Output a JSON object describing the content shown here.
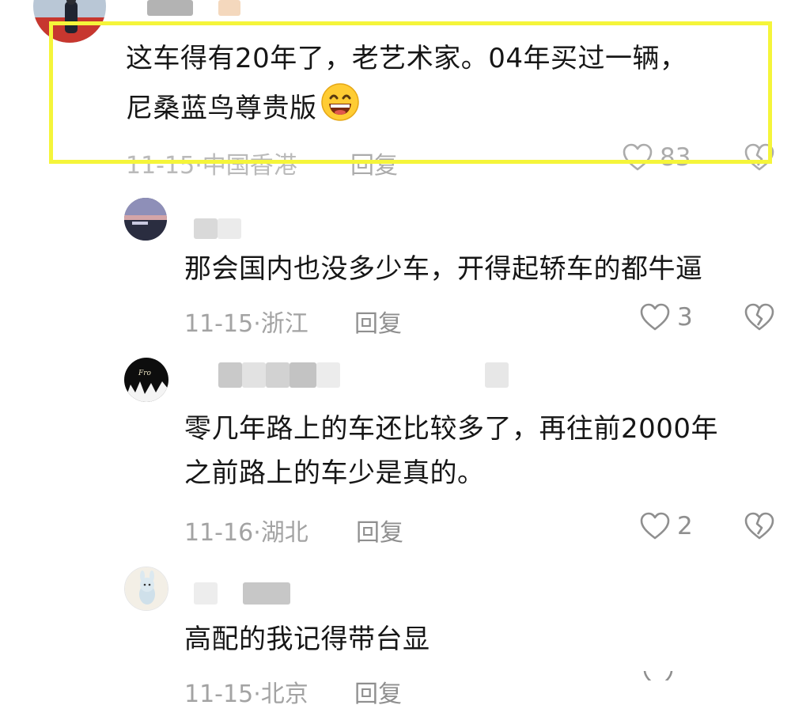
{
  "comments": [
    {
      "text_lines": [
        "这车得有20年了，老艺术家。04年买过一辆，",
        "尼桑蓝鸟尊贵版"
      ],
      "emoji": "grinning-face-emoji",
      "date": "11-15",
      "location": "中国香港",
      "reply_label": "回复",
      "likes": "83"
    },
    {
      "text_lines": [
        "那会国内也没多少车，开得起轿车的都牛逼"
      ],
      "date": "11-15",
      "location": "浙江",
      "reply_label": "回复",
      "likes": "3"
    },
    {
      "text_lines": [
        "零几年路上的车还比较多了，再往前2000年",
        "之前路上的车少是真的。"
      ],
      "date": "11-16",
      "location": "湖北",
      "reply_label": "回复",
      "likes": "2"
    },
    {
      "text_lines": [
        "高配的我记得带台显"
      ],
      "date": "11-15",
      "location": "北京",
      "reply_label": "回复"
    }
  ],
  "meta_separator": "·",
  "colors": {
    "highlight_border": "#f5f53a",
    "text": "#161616",
    "meta": "#a3a3a3",
    "icon": "#8f8f8f"
  }
}
